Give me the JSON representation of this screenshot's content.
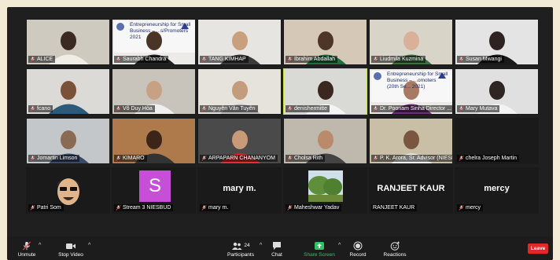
{
  "participants_tiles": [
    {
      "name": "ALICE",
      "type": "video",
      "bg": "#cfcac0",
      "person": "#3a2a22",
      "shirt": "#f0ece6"
    },
    {
      "name": "Saurabh Chandra",
      "type": "video",
      "bg": "#ecebe8",
      "person": "#4a3426",
      "shirt": "#222222",
      "slide": [
        "Entrepreneurship for Small",
        "Business – ...s/Promoters",
        "2021"
      ]
    },
    {
      "name": "TANG KIMHAP",
      "type": "video",
      "bg": "#e7e5e2",
      "person": "#c9a07e",
      "shirt": "#3a3a3a"
    },
    {
      "name": "Ibrahim Abdallah",
      "type": "video",
      "bg": "#d6c8b6",
      "person": "#4d3527",
      "shirt": "#1f6f3a"
    },
    {
      "name": "Liudmila Kuzmina",
      "type": "video",
      "bg": "#d8d4c8",
      "person": "#d9b199",
      "shirt": "#3f6f3f"
    },
    {
      "name": "Susan Mwangi",
      "type": "video",
      "bg": "#e4e4e4",
      "person": "#2e2320",
      "shirt": "#1a1a1a"
    },
    {
      "name": "fcano",
      "type": "video",
      "bg": "#dcdad6",
      "person": "#7a5238",
      "shirt": "#2d5a78"
    },
    {
      "name": "Võ Duy Hòa",
      "type": "video",
      "bg": "#c9c4bb",
      "person": "#c7a184",
      "shirt": "#efefef"
    },
    {
      "name": "Nguyễn Văn Tuyên",
      "type": "video",
      "bg": "#e6e2dc",
      "person": "#c29c7c",
      "shirt": "#bdbdbd"
    },
    {
      "name": "denishermitte",
      "type": "video",
      "speaking": true,
      "bg": "#d9d9d6",
      "person": "#3a2820",
      "shirt": "#f4f4f4"
    },
    {
      "name": "Dr. Poonam Sinha Director ...",
      "type": "video",
      "bg": "#ebe9e6",
      "person": "#a97a63",
      "shirt": "#6f2e7a",
      "slide": [
        "Entrepreneurship for Small",
        "Business – ...omoters",
        "(20th Se... 2021)"
      ]
    },
    {
      "name": "Mary Mutava",
      "type": "video",
      "bg": "#e0e0e0",
      "person": "#2f2522",
      "shirt": "#f3f3f3"
    },
    {
      "name": "Jomartin Limson",
      "type": "video",
      "bg": "#c3c7c9",
      "person": "#8a6a52",
      "shirt": "#3a4a6a"
    },
    {
      "name": "KIMARO",
      "type": "video",
      "bg": "#ae7a4c",
      "person": "#3b2418",
      "shirt": "#333333"
    },
    {
      "name": "ARPAPARN CHANANYOM",
      "type": "video",
      "bg": "#4a4a4a",
      "person": "#c89a78",
      "shirt": "#e0312e"
    },
    {
      "name": "Cholsa Rith",
      "type": "video",
      "bg": "#bfb8ad",
      "person": "#b98b6a",
      "shirt": "#444444"
    },
    {
      "name": "P. K. Arora, Sr. Advisor (NIESBUD)",
      "type": "video",
      "bg": "#c9bfa7",
      "person": "#7a5540",
      "shirt": "#ffffff"
    },
    {
      "name": "chelra Joseph Martin",
      "type": "blank"
    },
    {
      "name": "Patri Som",
      "type": "avatar"
    },
    {
      "name": "Stream 3 NIESBUD",
      "type": "letter",
      "letter": "S"
    },
    {
      "name": "mary m.",
      "type": "text",
      "display": "mary m."
    },
    {
      "name": "Maheshwar Yadav",
      "type": "photo"
    },
    {
      "name": "RANJEET KAUR",
      "type": "text",
      "display": "RANJEET KAUR",
      "nomute": true
    },
    {
      "name": "mercy",
      "type": "text",
      "display": "mercy"
    }
  ],
  "toolbar": {
    "unmute": "Unmute",
    "stop_video": "Stop Video",
    "participants": "Participants",
    "participants_count": "24",
    "chat": "Chat",
    "share_screen": "Share Screen",
    "record": "Record",
    "reactions": "Reactions",
    "leave": "Leave"
  },
  "colors": {
    "accent_green": "#31c466",
    "leave_red": "#e02828",
    "speaking_border": "#c8e04a",
    "mute_red": "#e04848"
  }
}
